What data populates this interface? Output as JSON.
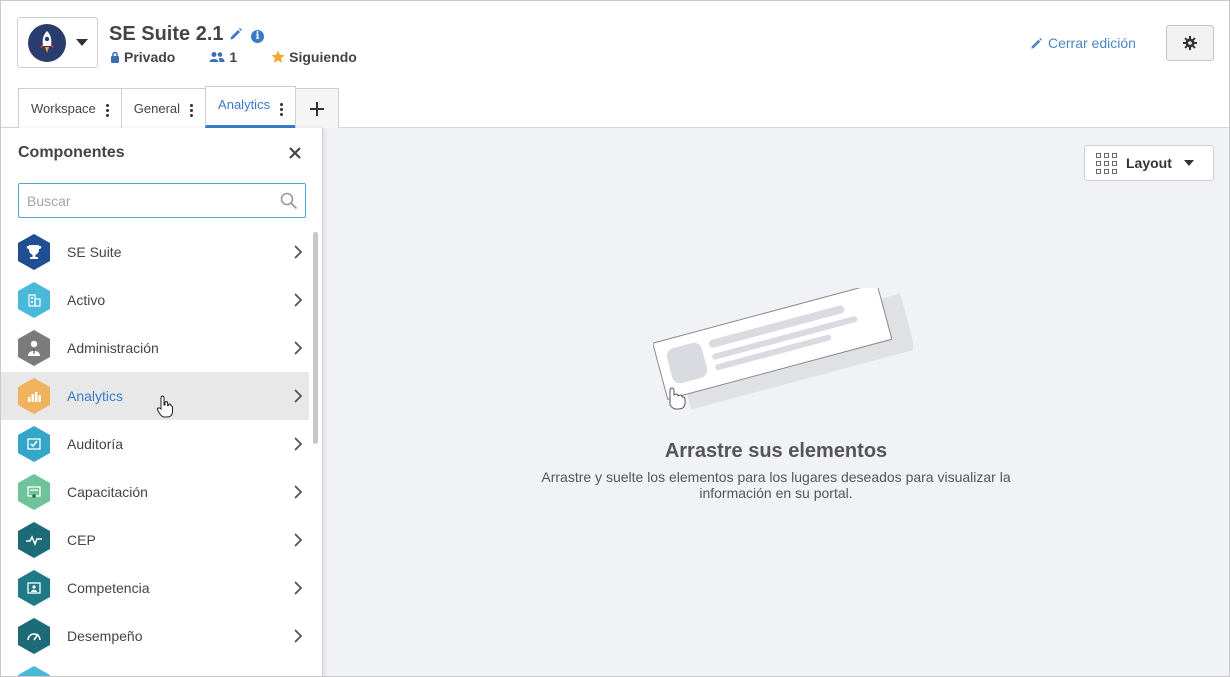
{
  "header": {
    "title": "SE Suite 2.1",
    "privacy": "Privado",
    "members": "1",
    "following": "Siguiendo",
    "close_edit": "Cerrar edición"
  },
  "tabs": [
    {
      "label": "Workspace"
    },
    {
      "label": "General"
    },
    {
      "label": "Analytics"
    }
  ],
  "sidebar": {
    "title": "Componentes",
    "search_placeholder": "Buscar",
    "items": [
      {
        "label": "SE Suite",
        "color": "#1f4f92",
        "icon": "trophy-icon"
      },
      {
        "label": "Activo",
        "color": "#4ab8d8",
        "icon": "building-icon"
      },
      {
        "label": "Administración",
        "color": "#7b7b7b",
        "icon": "person-icon"
      },
      {
        "label": "Analytics",
        "color": "#f0b25c",
        "icon": "bar-chart-icon"
      },
      {
        "label": "Auditoría",
        "color": "#34a6c8",
        "icon": "checklist-icon"
      },
      {
        "label": "Capacitación",
        "color": "#6fc29a",
        "icon": "certificate-icon"
      },
      {
        "label": "CEP",
        "color": "#1d6b78",
        "icon": "pulse-icon"
      },
      {
        "label": "Competencia",
        "color": "#1d7a86",
        "icon": "id-card-icon"
      },
      {
        "label": "Desempeño",
        "color": "#1d6b78",
        "icon": "gauge-icon"
      }
    ]
  },
  "main": {
    "layout_label": "Layout",
    "empty_title": "Arrastre sus elementos",
    "empty_desc": "Arrastre y suelte los elementos para los lugares deseados para visualizar la información en su portal."
  }
}
